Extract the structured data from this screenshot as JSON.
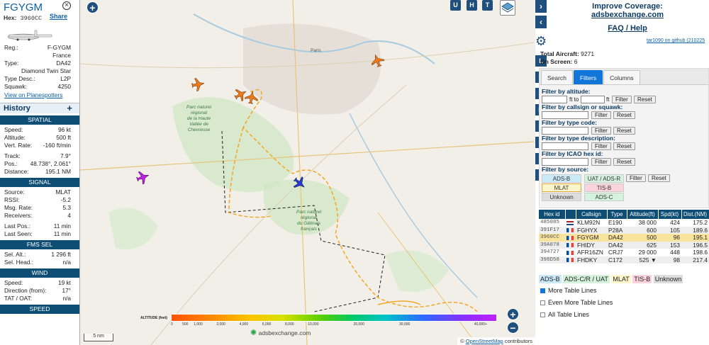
{
  "aircraft": {
    "callsign": "FGYGM",
    "hex_label": "Hex:",
    "hex": "3960CC",
    "share": "Share",
    "details": [
      {
        "k": "Reg.:",
        "v": "F-GYGM"
      },
      {
        "k": "Country:",
        "v": "France"
      },
      {
        "k": "Type:",
        "v": "DA42"
      },
      {
        "k": "Model:",
        "v": "Diamond Twin Star"
      },
      {
        "k": "Type Desc.:",
        "v": "L2P"
      },
      {
        "k": "Squawk:",
        "v": "4250"
      }
    ],
    "planespotters": "View on Planespotters"
  },
  "history": {
    "title": "History",
    "plus": "+"
  },
  "sections": {
    "spatial": {
      "title": "SPATIAL",
      "rows": [
        {
          "k": "Speed:",
          "v": "96 kt"
        },
        {
          "k": "Altitude:",
          "v": "500 ft"
        },
        {
          "k": "Vert. Rate:",
          "v": "-160 ft/min"
        },
        {
          "k": "Track:",
          "v": "7.9°"
        },
        {
          "k": "Pos.:",
          "v": "48.738°, 2.061°"
        },
        {
          "k": "Distance:",
          "v": "195.1 NM"
        }
      ]
    },
    "signal": {
      "title": "SIGNAL",
      "rows": [
        {
          "k": "Source:",
          "v": "MLAT"
        },
        {
          "k": "RSSI:",
          "v": "-5.2"
        },
        {
          "k": "Msg. Rate:",
          "v": "5.3"
        },
        {
          "k": "Receivers:",
          "v": "4"
        },
        {
          "k": "Last Pos.:",
          "v": "11 min"
        },
        {
          "k": "Last Seen:",
          "v": "11 min"
        }
      ]
    },
    "fms": {
      "title": "FMS SEL",
      "rows": [
        {
          "k": "Sel. Alt.:",
          "v": "1 296 ft"
        },
        {
          "k": "Sel. Head.:",
          "v": "n/a"
        }
      ]
    },
    "wind": {
      "title": "WIND",
      "rows": [
        {
          "k": "Speed:",
          "v": "19 kt"
        },
        {
          "k": "Direction (from):",
          "v": "17°"
        },
        {
          "k": "TAT / OAT:",
          "v": "n/a"
        }
      ]
    },
    "speed": {
      "title": "SPEED"
    }
  },
  "map": {
    "zoom_in": "+",
    "zoom_out": "−",
    "top_buttons": [
      "U",
      "H",
      "T"
    ],
    "side_buttons": [
      "L",
      "O",
      "K",
      "M",
      "P",
      "I",
      "R",
      "F"
    ],
    "altitude_title": "ALTITUDE (feet)",
    "altitude_ticks": [
      "0",
      "500",
      "1,000",
      "2,000",
      "4,000",
      "6,000",
      "8,000",
      "10,000",
      "20,000",
      "30,000",
      "40,000+"
    ],
    "logo": "adsbexchange.com",
    "scale": "5 nm",
    "attribution_prefix": "©",
    "attribution_link": "OpenStreetMap",
    "attribution_suffix": "contributors",
    "labels": {
      "paris": "Paris",
      "park1": "Parc naturel\nrégional\nde la Haute\nVallée de\nChevreuse",
      "park2": "Parc naturel\nrégional\ndu Gâtinais\nfrançais"
    }
  },
  "right": {
    "improve_1": "Improve Coverage:",
    "improve_2": "adsbexchange.com",
    "faq": "FAQ / Help",
    "github": "tar1090 on github (210225",
    "total_label": "Total Aircraft:",
    "total": "9271",
    "onscreen_label": "On Screen:",
    "onscreen": "6",
    "tabs": [
      "Search",
      "Filters",
      "Columns"
    ],
    "filters": {
      "altitude": "Filter by altitude:",
      "ft_to": "ft to",
      "ft": "ft",
      "callsign": "Filter by callsign or squawk:",
      "type_code": "Filter by type code:",
      "type_desc": "Filter by type description:",
      "icao": "Filter by ICAO hex id:",
      "source": "Filter by source:",
      "filter_btn": "Filter",
      "reset_btn": "Reset",
      "sources": [
        "ADS-B",
        "UAT / ADS-R",
        "MLAT",
        "TIS-B",
        "Unknown",
        "ADS-C"
      ]
    },
    "table": {
      "headers": [
        "Hex id",
        "",
        "Callsign",
        "Type",
        "Altitude(ft)",
        "Spd(kt)",
        "Dist.(NM)"
      ],
      "rows": [
        {
          "hex": "485085",
          "flag": "nl",
          "cs": "KLM92N",
          "type": "E190",
          "alt": "38 000",
          "spd": "424",
          "dist": "175.2"
        },
        {
          "hex": "391F17",
          "flag": "fr",
          "cs": "FGHYX",
          "type": "P28A",
          "alt": "600",
          "spd": "105",
          "dist": "189.6"
        },
        {
          "hex": "3960CC",
          "flag": "fr",
          "cs": "FGYGM",
          "type": "DA42",
          "alt": "500",
          "spd": "96",
          "dist": "195.1"
        },
        {
          "hex": "39A078",
          "flag": "fr",
          "cs": "FHIDY",
          "type": "DA42",
          "alt": "625",
          "spd": "153",
          "dist": "196.5"
        },
        {
          "hex": "394727",
          "flag": "fr",
          "cs": "AFR16ZN",
          "type": "CRJ7",
          "alt": "29 000",
          "spd": "448",
          "dist": "198.6"
        },
        {
          "hex": "398D58",
          "flag": "fr",
          "cs": "FHDKY",
          "type": "C172",
          "alt": "525 ▼",
          "spd": "98",
          "dist": "217.4"
        }
      ]
    },
    "legend": [
      "ADS-B",
      "ADS-C/R / UAT",
      "MLAT",
      "TIS-B",
      "Unknown"
    ],
    "options": [
      "More Table Lines",
      "Even More Table Lines",
      "All Table Lines"
    ]
  }
}
